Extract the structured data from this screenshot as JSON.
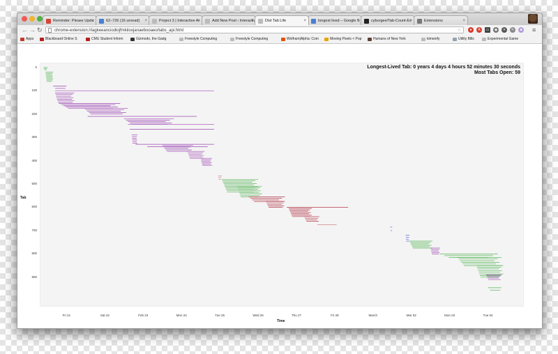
{
  "browser": {
    "tabs": [
      {
        "label": "Reminder: Please Upda",
        "color": "#d44638"
      },
      {
        "label": "62–726 (16 unread)",
        "color": "#4a7fd4"
      },
      {
        "label": "Project 3 | Interactive Ar",
        "color": "#bbbbbb"
      },
      {
        "label": "Add New Post ‹ Interactiv",
        "color": "#bbbbbb"
      },
      {
        "label": "Dist Tab Life",
        "color": "#bbbbbb"
      },
      {
        "label": "longest lived – Google S",
        "color": "#4a7fd4"
      },
      {
        "label": "cyburgee/Tab-Count-Ex",
        "color": "#222222"
      },
      {
        "label": "Extensions",
        "color": "#777777"
      }
    ],
    "active_tab": 4,
    "url": "chrome-extension://iagkeeanciodiojfmkiioojanaebooaeo/tabs_api.html",
    "bookmarks": [
      {
        "label": "Apps",
        "color": "#c0392b"
      },
      {
        "label": "Blackboard Online S",
        "color": "#b71c1c"
      },
      {
        "label": "CMU Student Inform",
        "color": "#b71c1c"
      },
      {
        "label": "Gizmodo, the Gadg",
        "color": "#333333"
      },
      {
        "label": "Freestyle Computing",
        "color": "#bbbbbb"
      },
      {
        "label": "Freestyle Computing",
        "color": "#bbbbbb"
      },
      {
        "label": "Wolfram|Alpha: Com",
        "color": "#e65100"
      },
      {
        "label": "Moving Pixels < Pop",
        "color": "#e8a400"
      },
      {
        "label": "Humans of New York",
        "color": "#5d4037"
      },
      {
        "label": "kimonify",
        "color": "#bbbbbb"
      },
      {
        "label": "Utility Bills",
        "color": "#90a4ae"
      },
      {
        "label": "Experimental Game",
        "color": "#bbbbbb"
      }
    ]
  },
  "chart_data": {
    "type": "gantt",
    "title_lines": [
      "Longest-Lived Tab: 0 years 4 days 4 hours 52 minutes 30 seconds",
      "Most Tabs Open: 59"
    ],
    "xlabel": "Time",
    "ylabel": "Tab",
    "y_ticks": [
      "0",
      "100",
      "200",
      "300",
      "400",
      "500",
      "600",
      "700",
      "800",
      "900"
    ],
    "x_ticks": [
      "Fri 21",
      "Sat 22",
      "Feb 23",
      "Mon 24",
      "Tue 25",
      "Wed 26",
      "Thu 27",
      "Fri 28",
      "March",
      "Mar 02",
      "Mon 03",
      "Tue 04"
    ],
    "ylim": [
      -20,
      1020
    ],
    "x_unit": "days since Fri 21",
    "xlim": [
      -0.7,
      11.9
    ],
    "colors": {
      "green": "#3daa3d",
      "purple": "#8e2aa8",
      "red": "#a8162b",
      "pink": "#c97070",
      "blue": "#3a48c8"
    },
    "segments": [
      {
        "color": "green",
        "tab_start": 0,
        "tab_end": 10,
        "x_start": -0.6,
        "x_end": -0.5,
        "n": 3
      },
      {
        "color": "green",
        "tab_start": 20,
        "tab_end": 60,
        "x_start": -0.55,
        "x_end": -0.35,
        "n": 8
      },
      {
        "color": "purple",
        "tab_start": 80,
        "tab_end": 90,
        "x_start": -0.35,
        "x_end": 0.0,
        "n": 2
      },
      {
        "color": "purple",
        "tab_start": 100,
        "tab_end": 105,
        "x_start": -0.3,
        "x_end": 3.85,
        "n": 1
      },
      {
        "color": "purple",
        "tab_start": 110,
        "tab_end": 150,
        "x_start": -0.3,
        "x_end": 0.2,
        "n": 7
      },
      {
        "color": "purple",
        "tab_start": 155,
        "tab_end": 175,
        "x_start": -0.2,
        "x_end": 1.4,
        "n": 5
      },
      {
        "color": "purple",
        "tab_start": 175,
        "tab_end": 200,
        "x_start": 0.45,
        "x_end": 1.6,
        "n": 5
      },
      {
        "color": "purple",
        "tab_start": 210,
        "tab_end": 215,
        "x_start": 0.55,
        "x_end": 3.4,
        "n": 1
      },
      {
        "color": "purple",
        "tab_start": 220,
        "tab_end": 245,
        "x_start": 1.5,
        "x_end": 2.8,
        "n": 5
      },
      {
        "color": "purple",
        "tab_start": 245,
        "tab_end": 250,
        "x_start": 1.6,
        "x_end": 3.85,
        "n": 1
      },
      {
        "color": "purple",
        "tab_start": 265,
        "tab_end": 270,
        "x_start": 1.65,
        "x_end": 3.85,
        "n": 1
      },
      {
        "color": "purple",
        "tab_start": 290,
        "tab_end": 325,
        "x_start": 1.7,
        "x_end": 1.85,
        "n": 6
      },
      {
        "color": "purple",
        "tab_start": 330,
        "tab_end": 340,
        "x_start": 1.8,
        "x_end": 3.85,
        "n": 2
      },
      {
        "color": "purple",
        "tab_start": 335,
        "tab_end": 360,
        "x_start": 2.5,
        "x_end": 3.3,
        "n": 5
      },
      {
        "color": "purple",
        "tab_start": 360,
        "tab_end": 390,
        "x_start": 3.15,
        "x_end": 3.6,
        "n": 6
      },
      {
        "color": "purple",
        "tab_start": 390,
        "tab_end": 420,
        "x_start": 3.5,
        "x_end": 3.8,
        "n": 6
      },
      {
        "color": "pink",
        "tab_start": 465,
        "tab_end": 480,
        "x_start": 3.95,
        "x_end": 4.05,
        "n": 3
      },
      {
        "color": "green",
        "tab_start": 480,
        "tab_end": 535,
        "x_start": 4.05,
        "x_end": 5.0,
        "n": 10
      },
      {
        "color": "green",
        "tab_start": 510,
        "tab_end": 555,
        "x_start": 4.45,
        "x_end": 5.1,
        "n": 8
      },
      {
        "color": "red",
        "tab_start": 555,
        "tab_end": 575,
        "x_start": 4.75,
        "x_end": 5.7,
        "n": 4
      },
      {
        "color": "red",
        "tab_start": 575,
        "tab_end": 600,
        "x_start": 5.2,
        "x_end": 5.7,
        "n": 5
      },
      {
        "color": "red",
        "tab_start": 600,
        "tab_end": 605,
        "x_start": 5.75,
        "x_end": 7.35,
        "n": 1
      },
      {
        "color": "red",
        "tab_start": 605,
        "tab_end": 640,
        "x_start": 5.8,
        "x_end": 6.4,
        "n": 7
      },
      {
        "color": "red",
        "tab_start": 640,
        "tab_end": 660,
        "x_start": 6.2,
        "x_end": 6.6,
        "n": 4
      },
      {
        "color": "pink",
        "tab_start": 675,
        "tab_end": 680,
        "x_start": 6.55,
        "x_end": 7.05,
        "n": 1
      },
      {
        "color": "blue",
        "tab_start": 685,
        "tab_end": 700,
        "x_start": 8.45,
        "x_end": 8.5,
        "n": 2
      },
      {
        "color": "blue",
        "tab_start": 720,
        "tab_end": 745,
        "x_start": 8.85,
        "x_end": 8.95,
        "n": 4
      },
      {
        "color": "green",
        "tab_start": 745,
        "tab_end": 775,
        "x_start": 8.95,
        "x_end": 9.55,
        "n": 6
      },
      {
        "color": "purple",
        "tab_start": 775,
        "tab_end": 800,
        "x_start": 9.5,
        "x_end": 9.75,
        "n": 5
      },
      {
        "color": "green",
        "tab_start": 800,
        "tab_end": 815,
        "x_start": 9.75,
        "x_end": 11.25,
        "n": 3
      },
      {
        "color": "green",
        "tab_start": 815,
        "tab_end": 850,
        "x_start": 10.2,
        "x_end": 11.35,
        "n": 6
      },
      {
        "color": "green",
        "tab_start": 850,
        "tab_end": 900,
        "x_start": 10.7,
        "x_end": 11.4,
        "n": 8
      },
      {
        "color": "purple",
        "tab_start": 890,
        "tab_end": 910,
        "x_start": 10.95,
        "x_end": 11.35,
        "n": 4
      },
      {
        "color": "green",
        "tab_start": 945,
        "tab_end": 955,
        "x_start": 11.0,
        "x_end": 11.35,
        "n": 2
      }
    ]
  }
}
